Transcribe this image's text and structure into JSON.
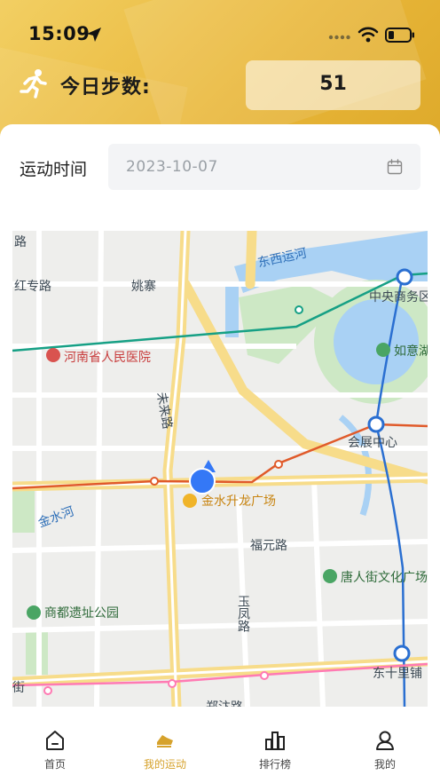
{
  "status_bar": {
    "time": "15:09"
  },
  "steps": {
    "label": "今日步数:",
    "value": "51"
  },
  "date_filter": {
    "label": "运动时间",
    "placeholder": "2023-10-07"
  },
  "map_labels": {
    "road_lu": "路",
    "hongzhuan": "红专路",
    "yaozhai": "姚寨",
    "dongxi_canal": "东西运河",
    "cbd": "中央商务区",
    "henan_hospital": "河南省人民医院",
    "ruyi": "如意湖",
    "weilai": "未来路",
    "convention": "会展中心",
    "jinshui_guangchang": "金水升龙广场",
    "jinshui_river": "金水河",
    "fuyuan": "福元路",
    "tangrenjie": "唐人街文化广场",
    "shangdu": "商都遗址公园",
    "yufeng": "玉凤路",
    "dongshili": "东十里铺",
    "jie": "街",
    "zhengbian": "郑汴路"
  },
  "tabs": [
    {
      "label": "首页",
      "icon": "home-icon",
      "active": false
    },
    {
      "label": "我的运动",
      "icon": "sport-icon",
      "active": true
    },
    {
      "label": "排行榜",
      "icon": "ranking-icon",
      "active": false
    },
    {
      "label": "我的",
      "icon": "profile-icon",
      "active": false
    }
  ],
  "colors": {
    "accent": "#e9b73a",
    "active_tab": "#d6a22c",
    "location": "#3478f6"
  }
}
